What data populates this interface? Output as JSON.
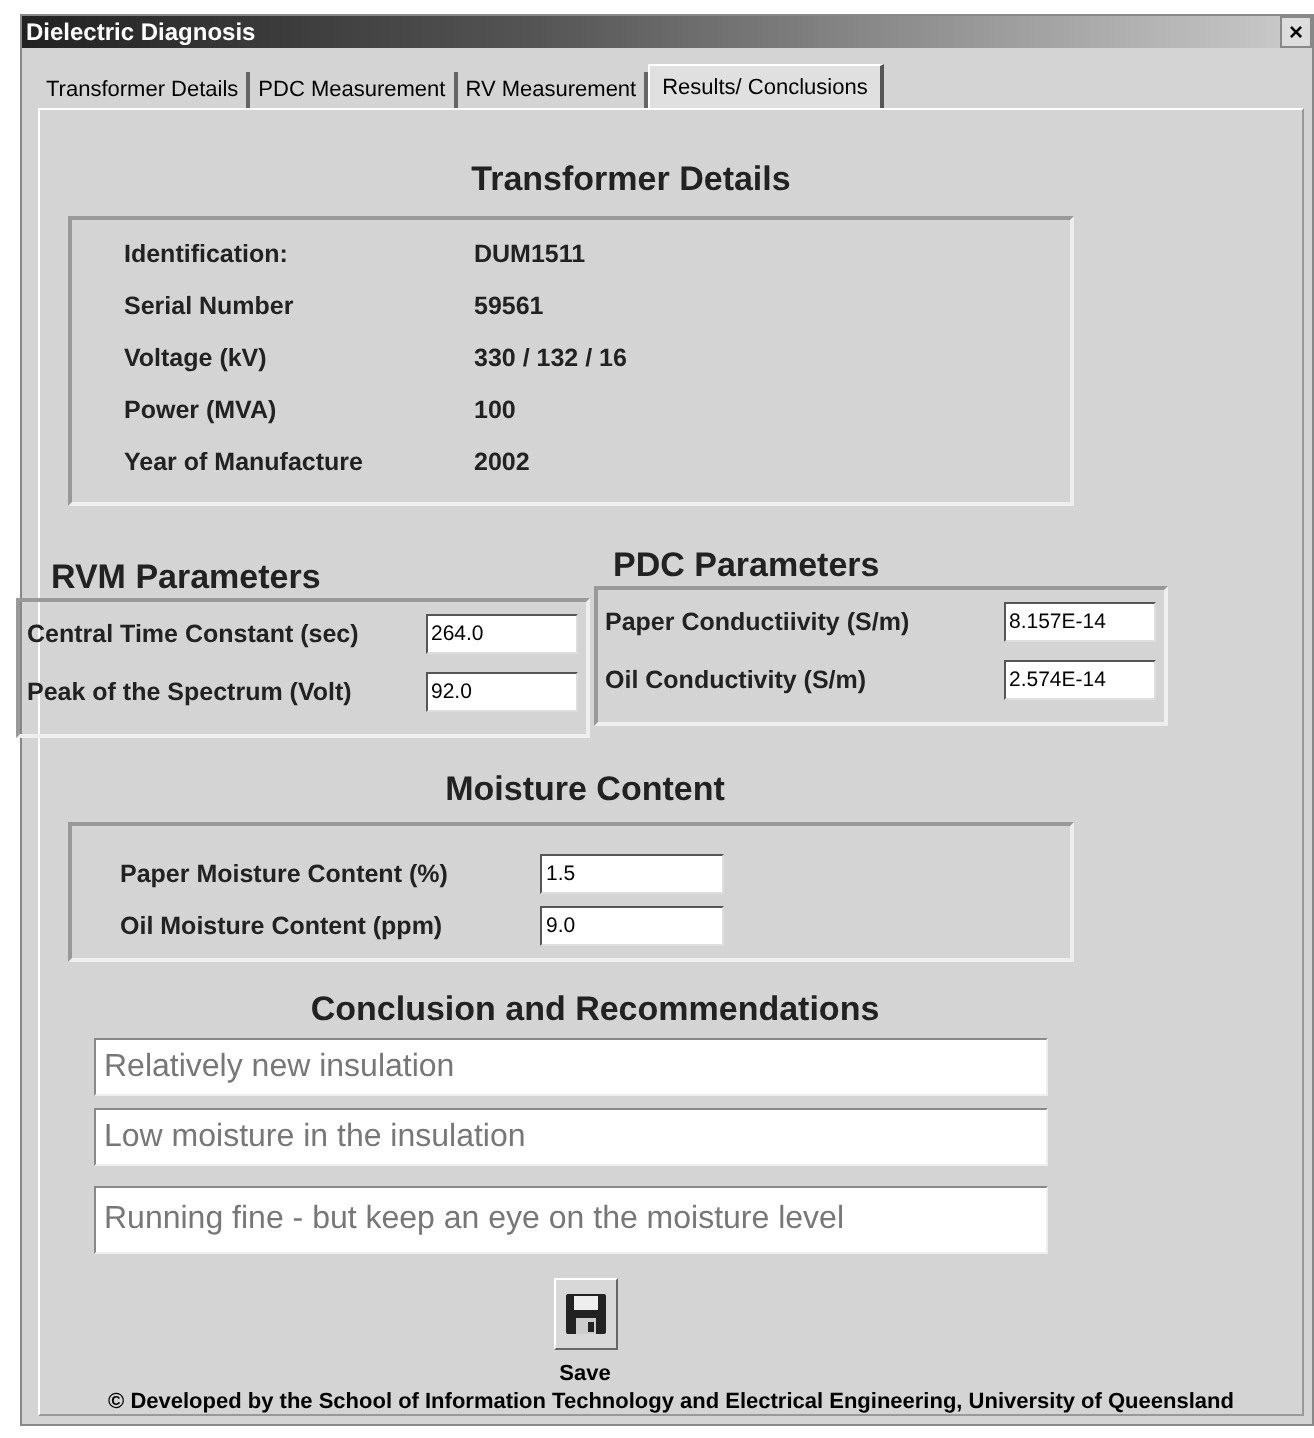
{
  "window": {
    "title": "Dielectric Diagnosis",
    "close": "×"
  },
  "tabs": [
    {
      "label": "Transformer Details",
      "selected": false
    },
    {
      "label": "PDC Measurement",
      "selected": false
    },
    {
      "label": "RV  Measurement",
      "selected": false
    },
    {
      "label": "Results/ Conclusions",
      "selected": true
    }
  ],
  "transformer_details": {
    "heading": "Transformer Details",
    "rows": [
      {
        "label": "Identification:",
        "value": "DUM1511"
      },
      {
        "label": "Serial Number",
        "value": "59561"
      },
      {
        "label": "Voltage (kV)",
        "value": "330  / 132  / 16"
      },
      {
        "label": "Power (MVA)",
        "value": "100"
      },
      {
        "label": "Year of Manufacture",
        "value": "2002"
      }
    ]
  },
  "rvm_parameters": {
    "heading": "RVM Parameters",
    "fields": [
      {
        "label": "Central Time Constant (sec)",
        "value": "264.0"
      },
      {
        "label": "Peak of the Spectrum (Volt)",
        "value": "92.0"
      }
    ]
  },
  "pdc_parameters": {
    "heading": "PDC Parameters",
    "fields": [
      {
        "label": "Paper Conductiivity (S/m)",
        "value": "8.157E-14"
      },
      {
        "label": "Oil Conductivity (S/m)",
        "value": "2.574E-14"
      }
    ]
  },
  "moisture_content": {
    "heading": "Moisture Content",
    "fields": [
      {
        "label": "Paper Moisture Content (%)",
        "value": "1.5"
      },
      {
        "label": "Oil Moisture Content (ppm)",
        "value": "9.0"
      }
    ]
  },
  "conclusions": {
    "heading": "Conclusion and Recommendations",
    "lines": [
      "Relatively new insulation",
      "Low moisture in the insulation",
      "Running fine - but keep an eye on the moisture level"
    ]
  },
  "save_label": "Save",
  "footer": "© Developed by the School of Information Technology and Electrical Engineering, University of Queensland"
}
